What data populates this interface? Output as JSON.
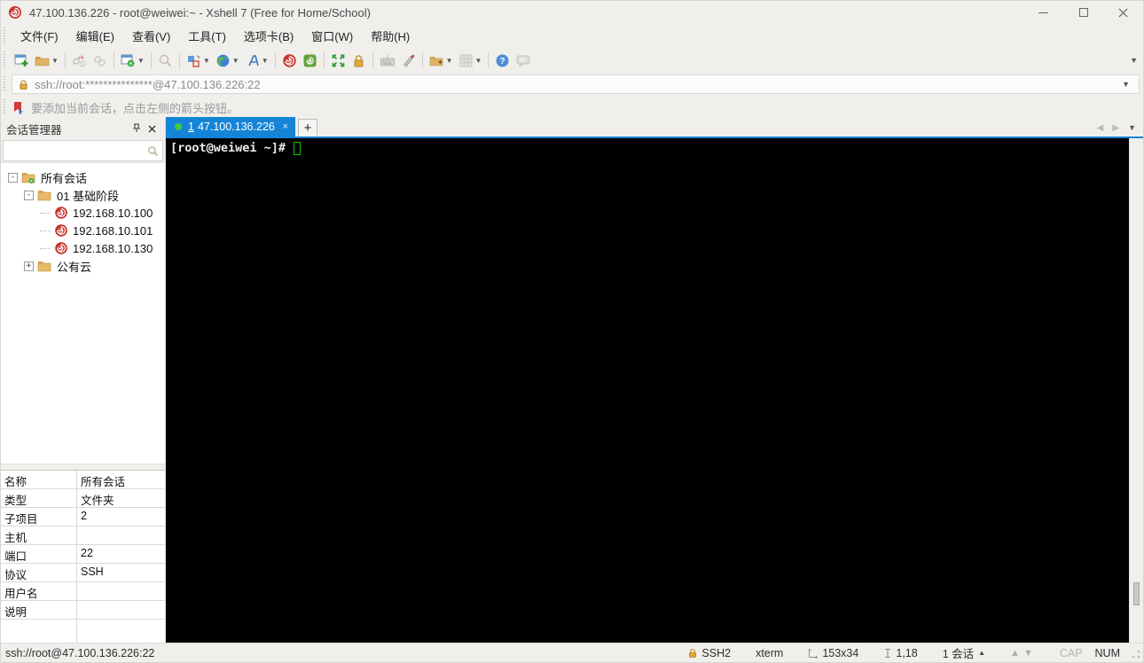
{
  "window": {
    "title": "47.100.136.226 - root@weiwei:~ - Xshell 7 (Free for Home/School)"
  },
  "menu": {
    "items": [
      {
        "label": "文件(F)"
      },
      {
        "label": "编辑(E)"
      },
      {
        "label": "查看(V)"
      },
      {
        "label": "工具(T)"
      },
      {
        "label": "选项卡(B)"
      },
      {
        "label": "窗口(W)"
      },
      {
        "label": "帮助(H)"
      }
    ]
  },
  "toolbar": {
    "buttons": [
      "new-session",
      "open",
      "disconnect",
      "reconnect",
      "properties",
      "find",
      "layout",
      "encoding-globe",
      "font",
      "xshell",
      "xftp",
      "fullscreen",
      "lock",
      "virtual-keyboard",
      "highlight",
      "new-folder",
      "grid-view",
      "help",
      "feedback"
    ]
  },
  "address_bar": {
    "value": "ssh://root:***************@47.100.136.226:22"
  },
  "info_bar": {
    "text": "要添加当前会话，点击左侧的箭头按钮。"
  },
  "session_manager": {
    "title": "会话管理器",
    "search_placeholder": "",
    "tree": [
      {
        "label": "所有会话",
        "expander": "-",
        "type": "root-folder"
      },
      {
        "label": "01 基础阶段",
        "expander": "-",
        "type": "folder"
      },
      {
        "label": "192.168.10.100",
        "type": "session"
      },
      {
        "label": "192.168.10.101",
        "type": "session"
      },
      {
        "label": "192.168.10.130",
        "type": "session"
      },
      {
        "label": "公有云",
        "expander": "+",
        "type": "folder"
      }
    ]
  },
  "properties": {
    "rows": [
      {
        "label": "名称",
        "value": "所有会话"
      },
      {
        "label": "类型",
        "value": "文件夹"
      },
      {
        "label": "子项目",
        "value": "2"
      },
      {
        "label": "主机",
        "value": ""
      },
      {
        "label": "端口",
        "value": "22"
      },
      {
        "label": "协议",
        "value": "SSH"
      },
      {
        "label": "用户名",
        "value": ""
      },
      {
        "label": "说明",
        "value": ""
      }
    ]
  },
  "tab_bar": {
    "active_tab": {
      "index": "1",
      "label": "47.100.136.226",
      "close": "×"
    },
    "new_tab_label": "+"
  },
  "terminal": {
    "prompt": "[root@weiwei ~]#"
  },
  "status_bar": {
    "left": "ssh://root@47.100.136.226:22",
    "protocol": "SSH2",
    "terminal_type": "xterm",
    "dimensions": "153x34",
    "cursor_position": "1,18",
    "session_count": "1 会话",
    "caps_indicator": "CAP",
    "num_indicator": "NUM"
  },
  "colors": {
    "tab_active": "#1584d6",
    "terminal_bg": "#000000",
    "cursor_green": "#17c40e",
    "xshell_red": "#c8342c",
    "folder_tan": "#eab84f",
    "chrome_bg": "#f0efec"
  }
}
